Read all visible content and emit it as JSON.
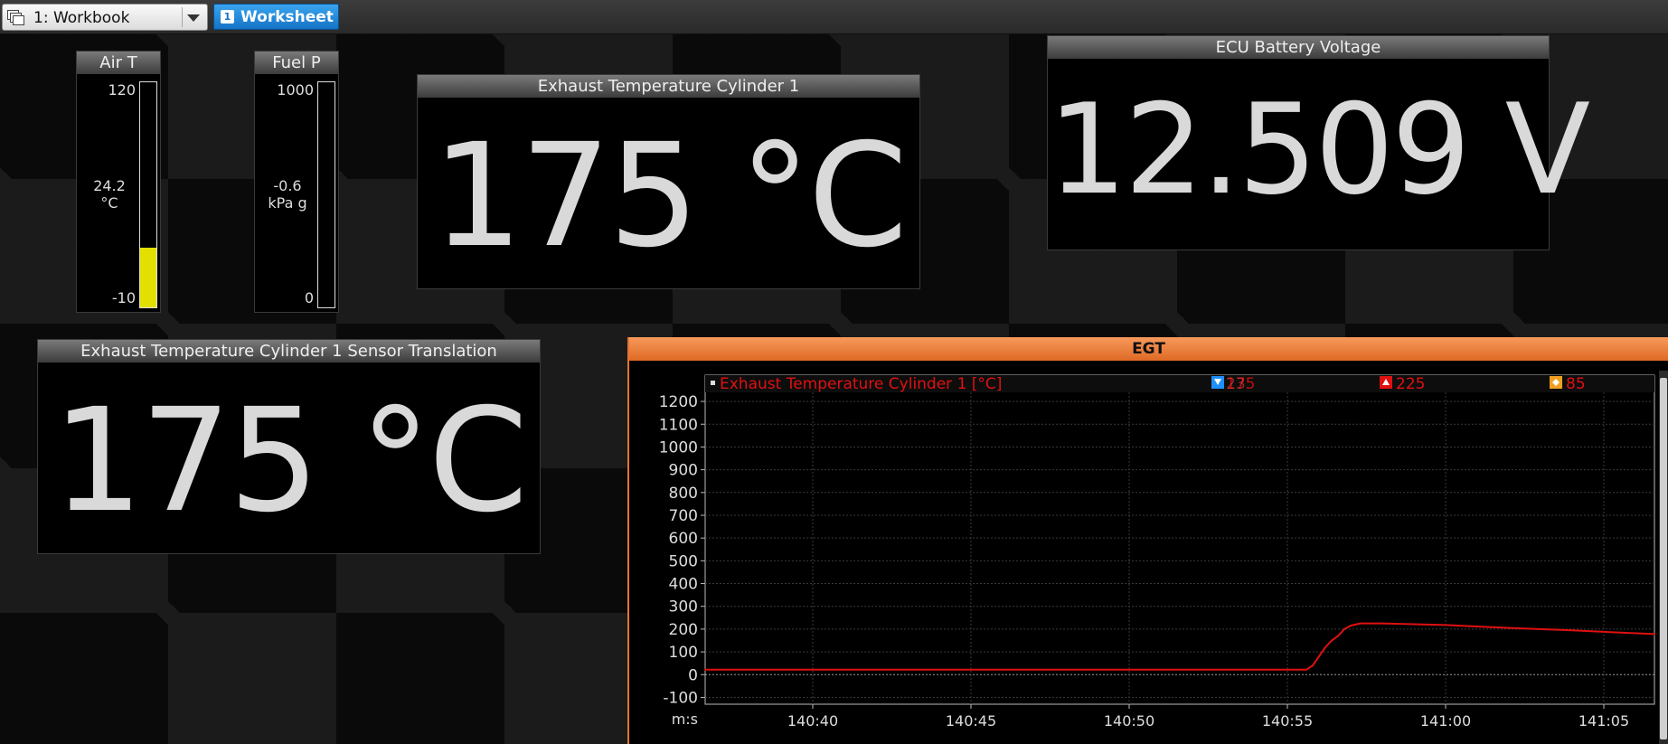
{
  "toolbar": {
    "workbook_label": "1: Workbook",
    "worksheet_number": "1",
    "worksheet_label": "Worksheet"
  },
  "gauges": {
    "air_t": {
      "title": "Air T",
      "max": "120",
      "min": "-10",
      "value": "24.2",
      "unit": "°C",
      "fill_fraction": 0.264
    },
    "fuel_p": {
      "title": "Fuel P",
      "max": "1000",
      "min": "0",
      "value": "-0.6",
      "unit": "kPa g",
      "fill_fraction": 0.0
    }
  },
  "panels": {
    "egt1": {
      "title": "Exhaust Temperature Cylinder 1",
      "value": "175 °C"
    },
    "battery": {
      "title": "ECU Battery Voltage",
      "value": "12.509 V"
    },
    "egt1_translation": {
      "title": "Exhaust Temperature Cylinder 1 Sensor Translation",
      "value": "175 °C"
    }
  },
  "chart": {
    "title": "EGT",
    "legend": {
      "series": "Exhaust Temperature Cylinder 1 [°C]",
      "current_a": "175",
      "current_b": "23",
      "max": "225",
      "mean": "85"
    },
    "colors": {
      "series": "#e01010",
      "header": "#e8742f",
      "min_marker": "#1f8fff",
      "max_marker": "#e01010",
      "avg_marker": "#f0a020"
    }
  },
  "chart_data": {
    "type": "line",
    "title": "EGT",
    "xlabel": "m:s",
    "ylabel": "",
    "x_tick_labels": [
      "140:40",
      "140:45",
      "140:50",
      "140:55",
      "141:00",
      "141:05"
    ],
    "y_tick_labels": [
      "1200",
      "1100",
      "1000",
      "900",
      "800",
      "700",
      "600",
      "500",
      "400",
      "300",
      "200",
      "100",
      "0",
      "-100"
    ],
    "ylim": [
      -130,
      1240
    ],
    "xlim": [
      "140:36.6",
      "141:06.6"
    ],
    "grid": true,
    "series": [
      {
        "name": "Exhaust Temperature Cylinder 1 [°C]",
        "x": [
          "140:36.6",
          "140:40",
          "140:45",
          "140:50",
          "140:55",
          "140:55.6",
          "140:55.8",
          "140:56.0",
          "140:56.2",
          "140:56.4",
          "140:56.6",
          "140:56.8",
          "140:57.0",
          "140:57.3",
          "140:58",
          "141:00",
          "141:02",
          "141:04",
          "141:05",
          "141:06.6"
        ],
        "y": [
          22,
          22,
          22,
          22,
          22,
          22,
          40,
          80,
          120,
          150,
          170,
          200,
          215,
          225,
          225,
          218,
          205,
          195,
          188,
          178
        ]
      }
    ]
  }
}
